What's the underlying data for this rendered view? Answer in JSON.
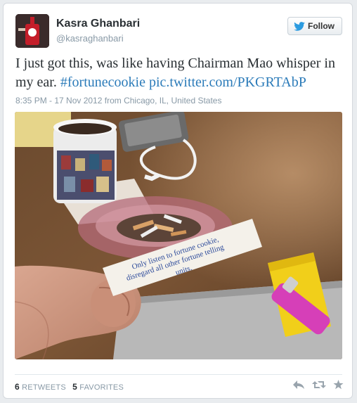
{
  "user": {
    "name": "Kasra Ghanbari",
    "handle": "@kasraghanbari"
  },
  "follow_label": "Follow",
  "tweet": {
    "text": "I just got this, was like having Chairman Mao whisper in my ear.",
    "hashtag": "#fortunecookie",
    "link": "pic.twitter.com/PKGRTAbP",
    "timestamp": "8:35 PM - 17 Nov 2012 from Chicago, IL, United States"
  },
  "photo": {
    "fortune_line1": "Only listen to fortune cookie,",
    "fortune_line2": "disregard all other fortune telling",
    "fortune_line3": "units."
  },
  "stats": {
    "retweets_count": "6",
    "retweets_label": "RETWEETS",
    "favorites_count": "5",
    "favorites_label": "FAVORITES"
  },
  "colors": {
    "link": "#2b7bb9",
    "name": "#292f33",
    "muted": "#8899a6",
    "follow_bird": "#2b9be0"
  },
  "icons": [
    "twitter-bird-icon",
    "reply-icon",
    "retweet-icon",
    "favorite-icon"
  ]
}
